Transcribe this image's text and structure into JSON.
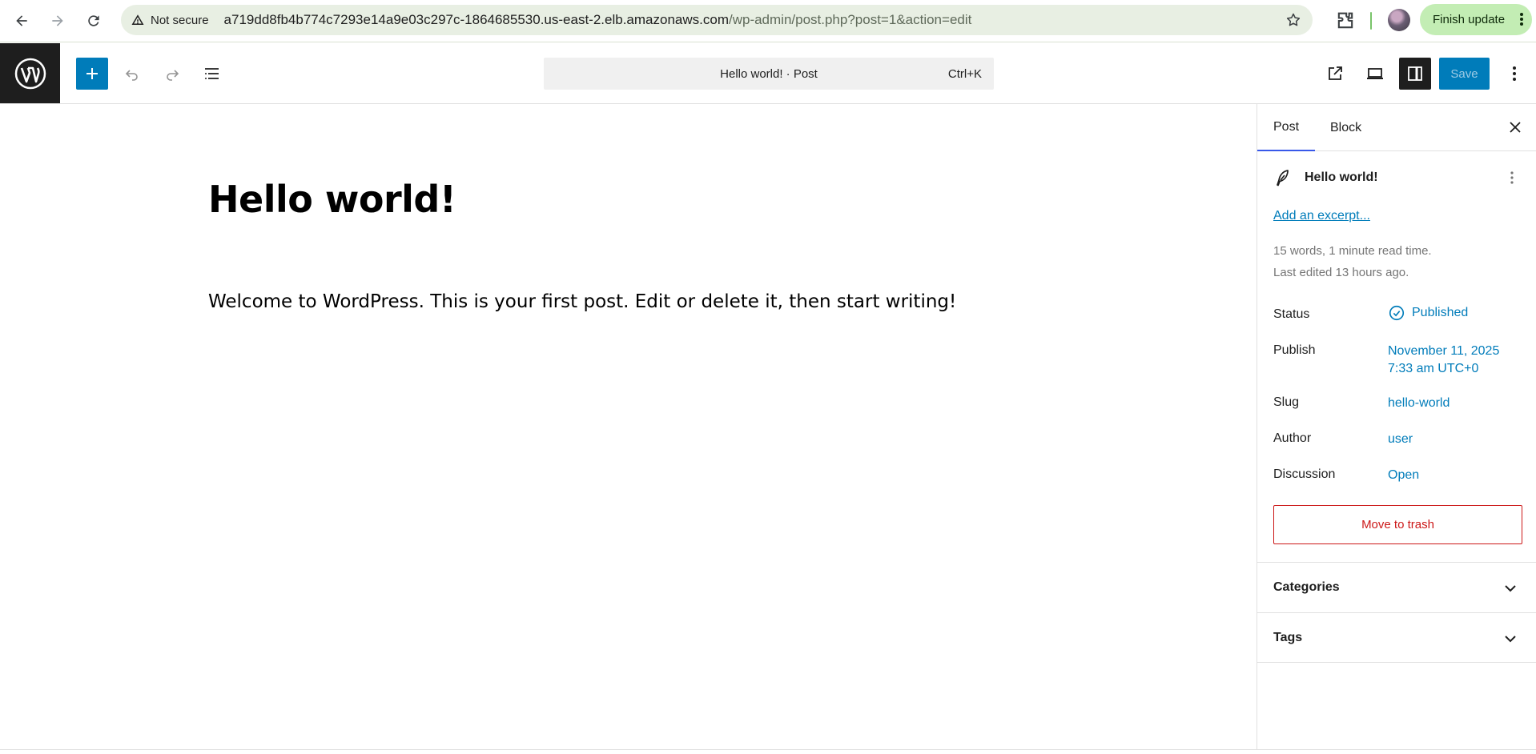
{
  "browser": {
    "security_label": "Not secure",
    "url_host": "a719dd8fb4b774c7293e14a9e03c297c-1864685530.us-east-2.elb.amazonaws.com",
    "url_path": "/wp-admin/post.php?post=1&action=edit",
    "finish_update_label": "Finish update"
  },
  "header": {
    "command_title": "Hello world! · Post",
    "command_shortcut": "Ctrl+K",
    "save_label": "Save"
  },
  "editor": {
    "title": "Hello world!",
    "paragraph": "Welcome to WordPress. This is your first post. Edit or delete it, then start writing!"
  },
  "sidebar": {
    "tabs": [
      {
        "label": "Post",
        "active": true
      },
      {
        "label": "Block",
        "active": false
      }
    ],
    "post_title": "Hello world!",
    "excerpt_link": "Add an excerpt...",
    "word_count": "15 words, 1 minute read time.",
    "last_edited": "Last edited 13 hours ago.",
    "rows": {
      "status": {
        "label": "Status",
        "value": "Published"
      },
      "publish": {
        "label": "Publish",
        "value_line1": "November 11, 2025",
        "value_line2": "7:33 am UTC+0"
      },
      "slug": {
        "label": "Slug",
        "value": "hello-world"
      },
      "author": {
        "label": "Author",
        "value": "user"
      },
      "discussion": {
        "label": "Discussion",
        "value": "Open"
      }
    },
    "trash_label": "Move to trash",
    "panels": {
      "categories": "Categories",
      "tags": "Tags"
    }
  },
  "colors": {
    "accent": "#007cba",
    "danger": "#cc1818",
    "dark": "#1e1e1e",
    "update_chip": "#c3edb4"
  }
}
